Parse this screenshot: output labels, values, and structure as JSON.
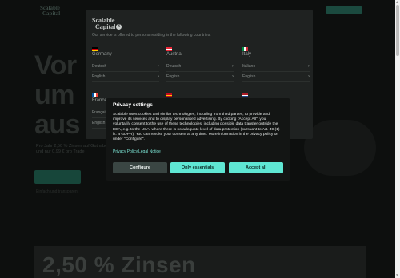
{
  "background": {
    "logo_line1": "Scalable",
    "logo_line2": "Capital",
    "hero_lines": [
      "Vor",
      "um",
      "aus"
    ],
    "sub_text": "Pro Jahr 2,50 % Zinsen auf Guthaben und nur 0,99 € pro Trade",
    "small_text": "Einfach und transparent",
    "band_text": "2,50 % Zinsen"
  },
  "country_modal": {
    "logo_line1": "Scalable",
    "logo_line2": "Capital",
    "description": "Our service is offered to persons residing in the following countries:",
    "countries": [
      {
        "name": "Germany",
        "languages": [
          "Deutsch",
          "English"
        ],
        "flag": [
          "#000000",
          "#dd0000",
          "#ffce00"
        ],
        "flag_dir": "h"
      },
      {
        "name": "Austria",
        "languages": [
          "Deutsch",
          "English"
        ],
        "flag": [
          "#ed2939",
          "#ffffff",
          "#ed2939"
        ],
        "flag_dir": "h"
      },
      {
        "name": "Italy",
        "languages": [
          "Italiano",
          "English"
        ],
        "flag": [
          "#009246",
          "#ffffff",
          "#ce2b37"
        ],
        "flag_dir": "v"
      },
      {
        "name": "France",
        "languages": [
          "Français",
          "English"
        ],
        "flag": [
          "#0055a4",
          "#ffffff",
          "#ef4135"
        ],
        "flag_dir": "v"
      },
      {
        "name": "",
        "languages": [
          "",
          ""
        ],
        "flag": [
          "#c60b1e",
          "#ffc400",
          "#c60b1e"
        ],
        "flag_dir": "h"
      },
      {
        "name": "",
        "languages": [
          "",
          ""
        ],
        "flag": [
          "#ae1c28",
          "#ffffff",
          "#21468b"
        ],
        "flag_dir": "h"
      }
    ],
    "chevron": "›"
  },
  "privacy": {
    "title": "Privacy settings",
    "text": "Scalable uses cookies and similar technologies, including from third parties, to provide and improve its services and to display personalised advertising. By clicking \"Accept All\", you voluntarily consent to the use of these technologies, including possible data transfer outside the EEA, e.g. to the USA, where there is no adequate level of data protection (pursuant to Art. 49 (1) lit. a GDPR). You can revoke your consent at any time. More information in the privacy policy or under \"Configure\".",
    "privacy_policy_link": "Privacy Policy",
    "legal_notice_link": "Legal Notice",
    "configure_label": "Configure",
    "essentials_label": "Only essentials",
    "accept_all_label": "Accept all",
    "accent_color": "#5fe7d3"
  },
  "scrollbar": {
    "up_icon": "▲",
    "down_icon": "▼"
  }
}
